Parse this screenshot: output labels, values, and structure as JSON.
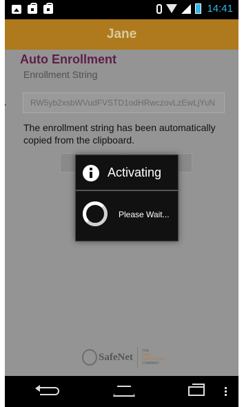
{
  "status_bar": {
    "left_icons": [
      "image-icon",
      "bag-icon",
      "download-icon"
    ],
    "time": "14:41",
    "right_icons": [
      "bluetooth-icon",
      "wifi-icon",
      "signal-icon",
      "battery-icon"
    ],
    "accent_color": "#33b5e5"
  },
  "title_bar": {
    "title": "Jane",
    "background": "#ae7a1d"
  },
  "enrollment": {
    "section_title": "Auto Enrollment",
    "field_label": "Enrollment String",
    "field_value": "RW5yb2xsbWVudFVSTD1odHRwczovLzEwLjYuN",
    "message": "The enrollment string has been automatically copied from the clipboard."
  },
  "dialog": {
    "title": "Activating",
    "message": "Please Wait...",
    "icon": "info-icon"
  },
  "footer": {
    "brand": "SafeNet",
    "tagline_lines": [
      "THE",
      "DATA",
      "PROTECTION",
      "COMPANY"
    ]
  },
  "nav_bar": {
    "buttons": [
      "back",
      "home",
      "recent-apps",
      "menu"
    ]
  }
}
